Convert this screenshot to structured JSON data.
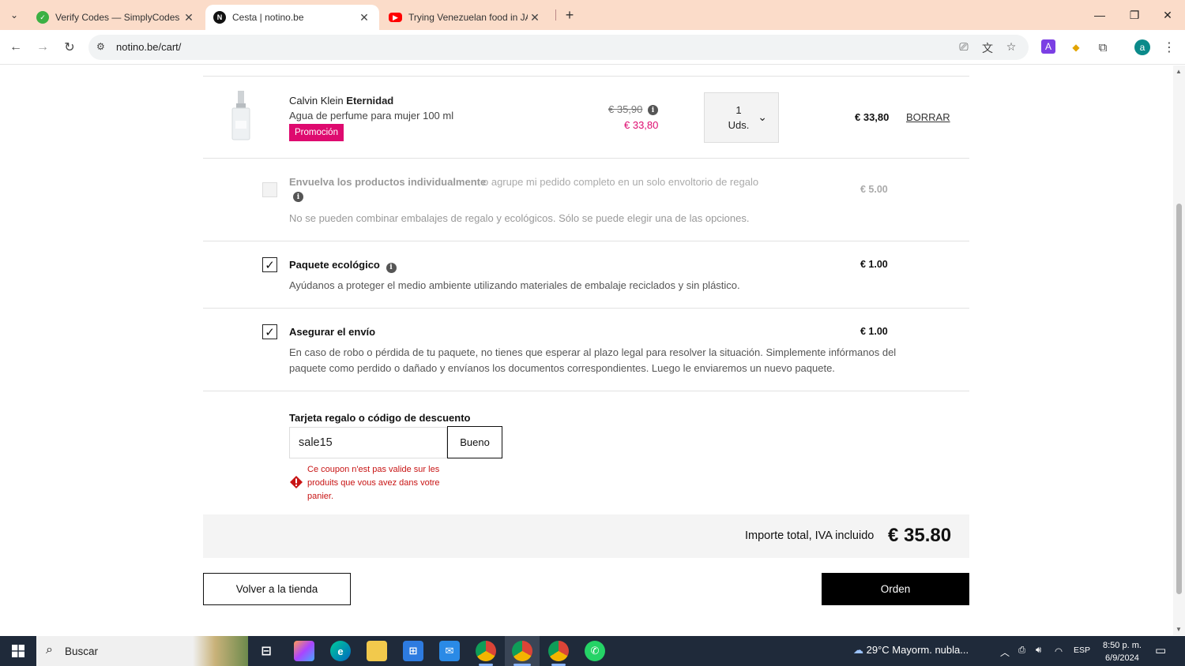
{
  "browser": {
    "tabs": [
      {
        "title": "Verify Codes — SimplyCodes",
        "icon": "simplycodes-icon",
        "color": "#3cb043"
      },
      {
        "title": "Cesta | notino.be",
        "icon": "notino-icon",
        "color": "#111111"
      },
      {
        "title": "Trying Venezuelan food in JAPAN",
        "icon": "youtube-icon",
        "color": "#ff0000"
      }
    ],
    "url": "notino.be/cart/"
  },
  "cart": {
    "item": {
      "brand": "Calvin Klein",
      "name": "Eternidad",
      "description": "Agua de perfume para mujer 100 ml",
      "badge": "Promoción",
      "old_price": "€ 35,90",
      "new_price": "€ 33,80",
      "qty": "1",
      "qty_unit": "Uds.",
      "line_total": "€ 33,80",
      "remove_label": "BORRAR"
    },
    "options": {
      "gift_wrap": {
        "title": "Envuelva los productos individualmente",
        "subtitle": "o agrupe mi pedido completo en un solo envoltorio de regalo",
        "description": "No se pueden combinar embalajes de regalo y ecológicos. Sólo se puede elegir una de las opciones.",
        "price": "€ 5.00"
      },
      "eco_package": {
        "title": "Paquete ecológico",
        "description": "Ayúdanos a proteger el medio ambiente utilizando materiales de embalaje reciclados y sin plástico.",
        "price": "€ 1.00"
      },
      "insurance": {
        "title": "Asegurar el envío",
        "description_line1": "En caso de robo o pérdida de tu paquete, no tienes que esperar al plazo legal para resolver la situación. Simplemente infórmanos del",
        "description_line2": "paquete como perdido o dañado y envíanos los documentos correspondientes. Luego le enviaremos un nuevo paquete.",
        "price": "€ 1.00"
      }
    },
    "coupon": {
      "label": "Tarjeta regalo o código de descuento",
      "value": "sale15",
      "button": "Bueno",
      "error": "Ce coupon n'est pas valide sur les produits que vous avez dans votre panier."
    },
    "total": {
      "label": "Importe total, IVA incluido",
      "value": "€ 35.80"
    },
    "actions": {
      "back": "Volver a la tienda",
      "order": "Orden"
    }
  },
  "taskbar": {
    "search_placeholder": "Buscar",
    "weather": "29°C  Mayorm. nubla...",
    "lang": "ESP",
    "time": "8:50 p. m.",
    "date": "6/9/2024"
  },
  "colors": {
    "accent": "#de0a6f",
    "error": "#c81515",
    "tabbar": "#fbdcc9"
  }
}
